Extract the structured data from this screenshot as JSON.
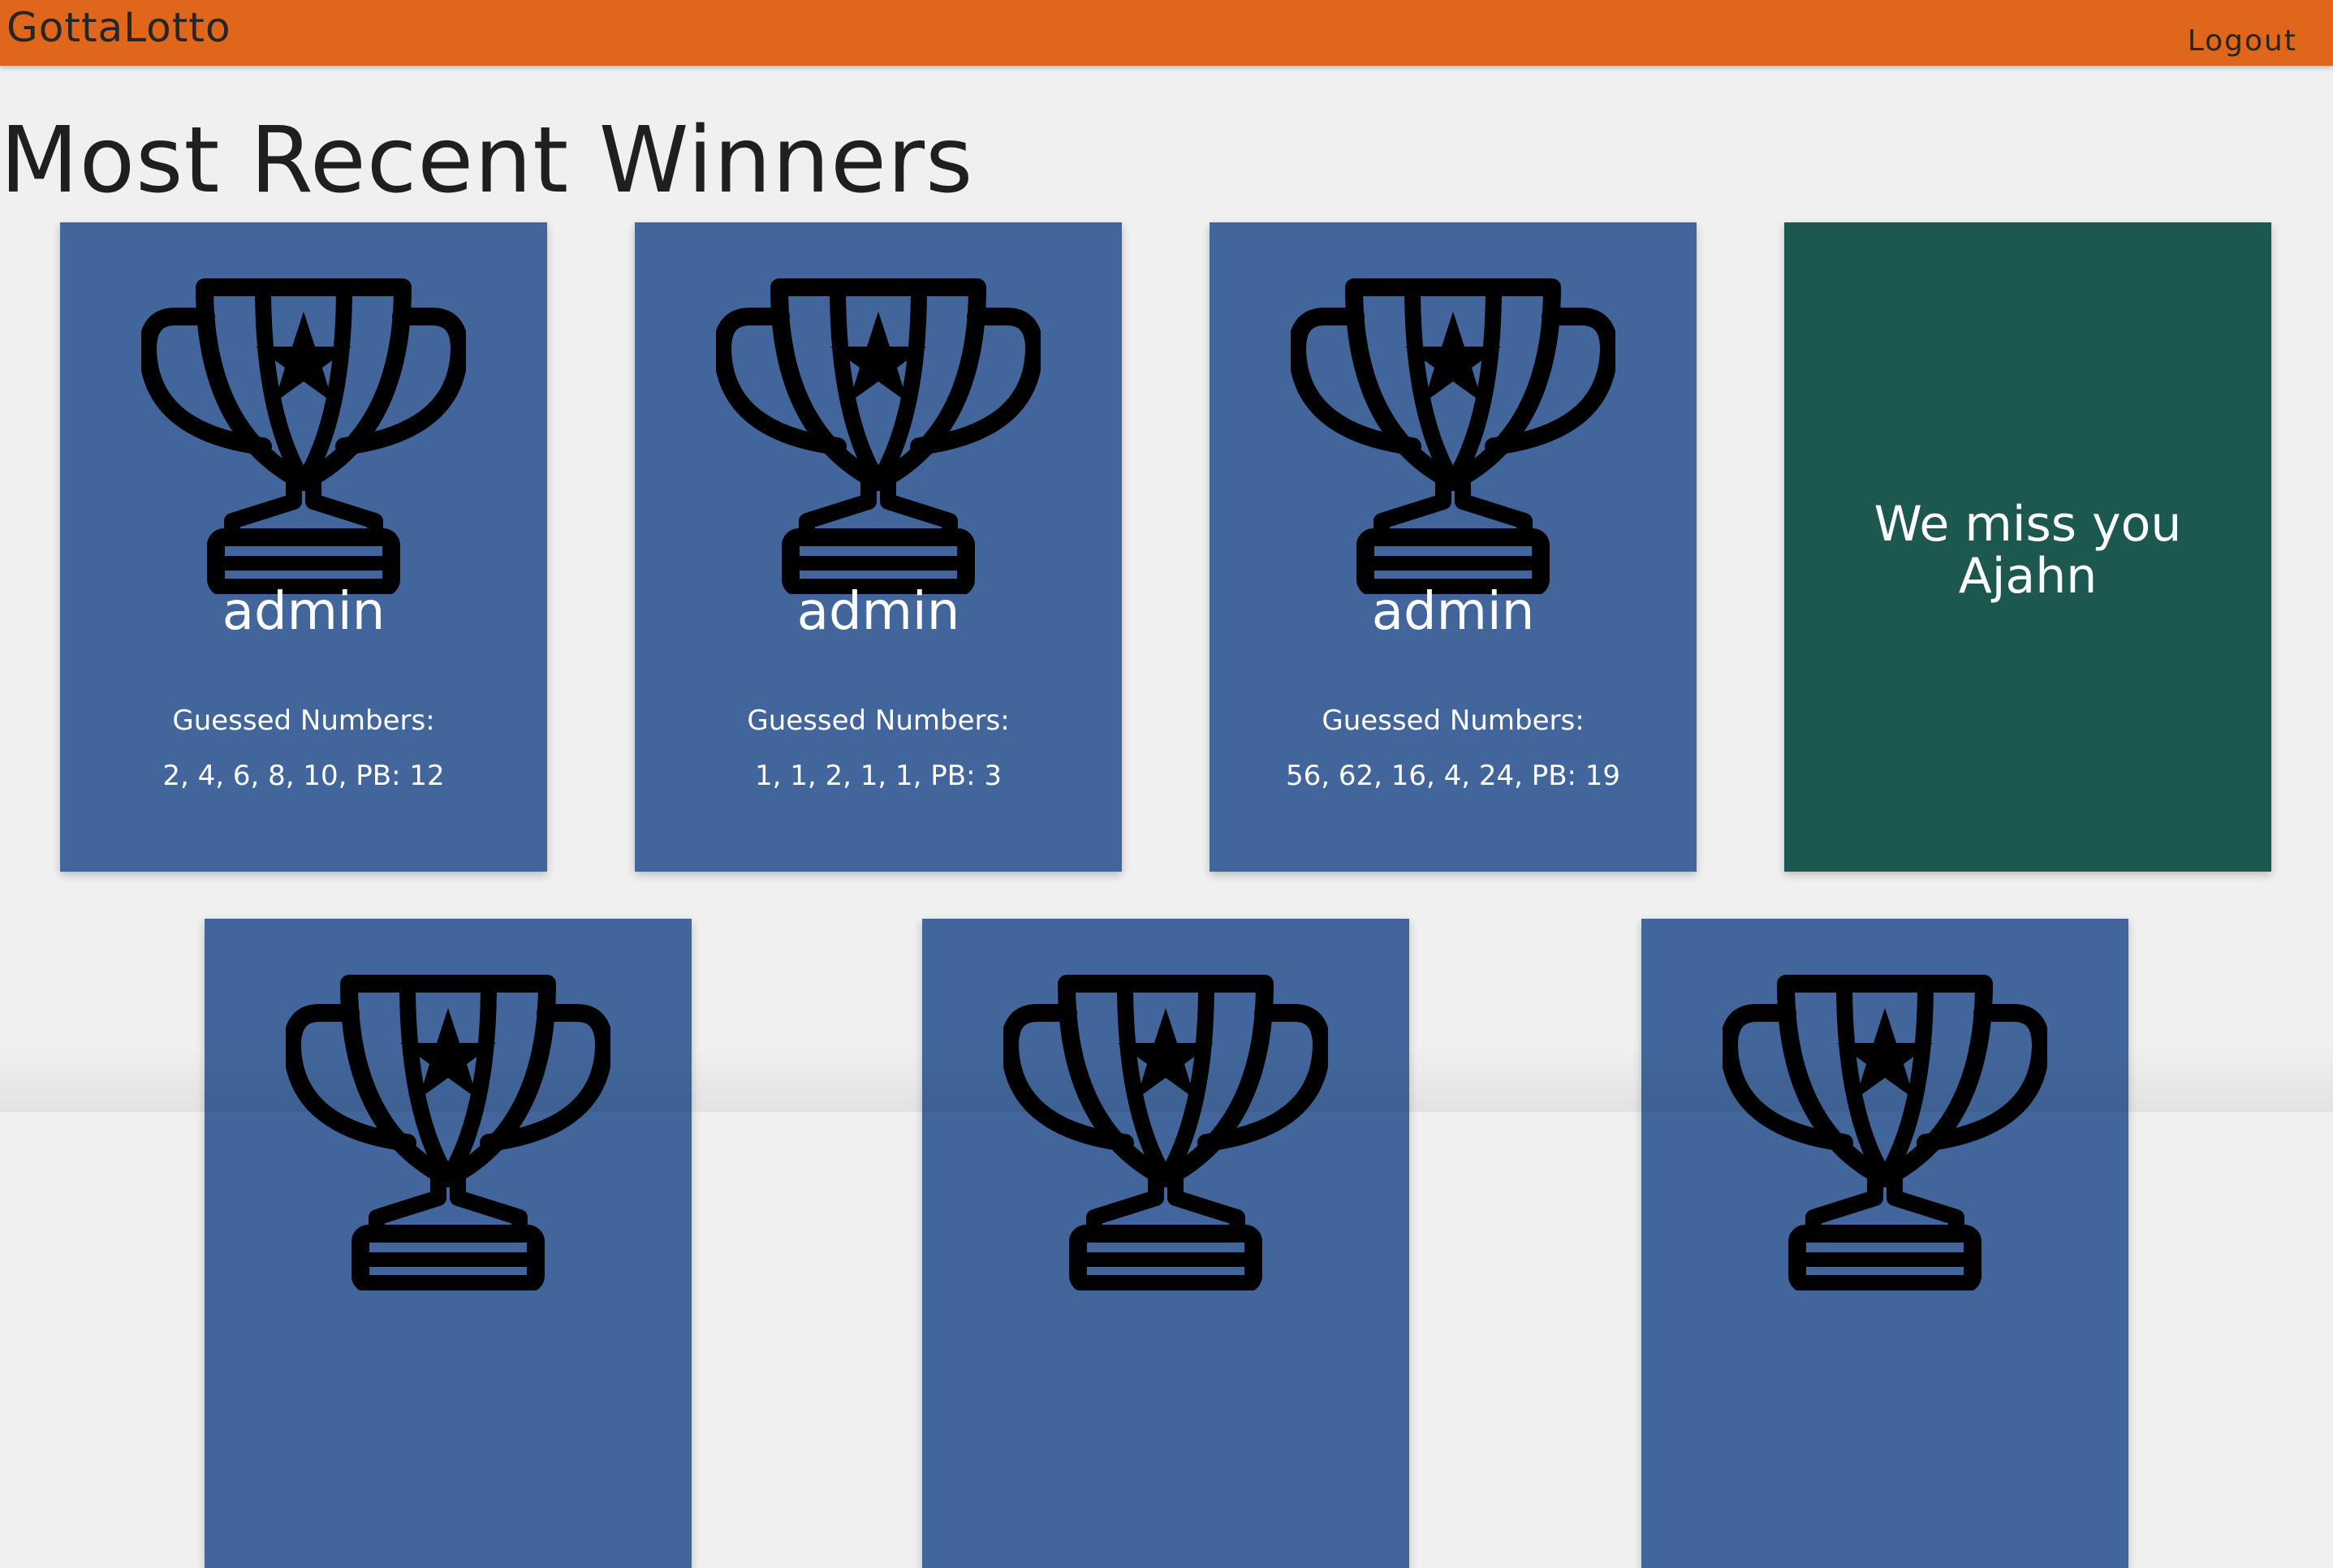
{
  "navbar": {
    "brand": "GottaLotto",
    "logout_label": "Logout"
  },
  "page": {
    "title": "Most Recent Winners"
  },
  "cards": [
    {
      "name": "admin",
      "guess_label": "Guessed Numbers:",
      "numbers": "2, 4, 6, 8, 10, PB: 12"
    },
    {
      "name": "admin",
      "guess_label": "Guessed Numbers:",
      "numbers": "1, 1, 2, 1, 1, PB: 3"
    },
    {
      "name": "admin",
      "guess_label": "Guessed Numbers:",
      "numbers": "56, 62, 16, 4, 24, PB: 19"
    }
  ],
  "miss_card": {
    "message": "We miss you Ajahn"
  },
  "colors": {
    "navbar": "#e0661b",
    "card_blue": "#42669b",
    "card_green": "#1c5750",
    "background": "#f0f0f0"
  },
  "icons": {
    "trophy": "trophy-icon",
    "star": "star-icon"
  }
}
